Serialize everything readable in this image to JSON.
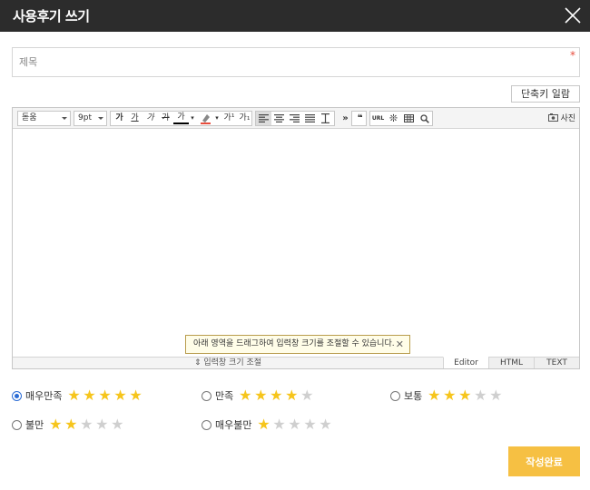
{
  "header": {
    "title": "사용후기 쓰기"
  },
  "subject": {
    "placeholder": "제목",
    "required_mark": "*"
  },
  "shortcut_button": "단축키 일람",
  "toolbar": {
    "font_family": "돋움",
    "font_size": "9pt",
    "format_buttons": [
      "가",
      "가",
      "가",
      "가",
      "가"
    ],
    "superscript": "가¹",
    "subscript": "가₁",
    "quote": "❝",
    "url": "URL",
    "photo_label": "사진"
  },
  "tooltip": {
    "text": "아래 영역을 드래그하여 입력창 크기를 조절할 수 있습니다.",
    "close": "✕"
  },
  "resize_bar": {
    "label": "⇕ 입력창 크기 조절"
  },
  "mode_tabs": [
    "Editor",
    "HTML",
    "TEXT"
  ],
  "ratings": [
    {
      "label": "매우만족",
      "stars": 5,
      "checked": true
    },
    {
      "label": "만족",
      "stars": 4,
      "checked": false
    },
    {
      "label": "보통",
      "stars": 3,
      "checked": false
    },
    {
      "label": "불만",
      "stars": 2,
      "checked": false
    },
    {
      "label": "매우불만",
      "stars": 1,
      "checked": false
    }
  ],
  "submit_button": "작성완료",
  "colors": {
    "header": "#2c2c2c",
    "accent": "#f6c043",
    "star": "#f6c51c",
    "radio": "#2b6cd5"
  },
  "icons": [
    "close-icon",
    "font-color-icon",
    "bg-color-icon",
    "align-left-icon",
    "align-center-icon",
    "align-right-icon",
    "align-justify-icon",
    "line-height-icon",
    "more-icon",
    "quote-icon",
    "url-icon",
    "special-char-icon",
    "table-icon",
    "search-icon",
    "photo-icon"
  ]
}
